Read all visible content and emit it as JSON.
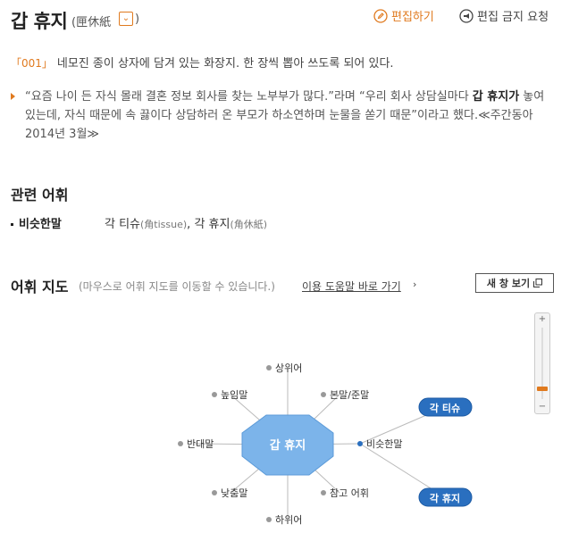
{
  "header": {
    "title": "갑 휴지",
    "hanja_open": "(",
    "hanja": "匣休紙",
    "hanja_toggle": "⌄",
    "hanja_close": ")",
    "edit_label": "편집하기",
    "block_label": "편집 금지 요청"
  },
  "definition": {
    "number": "「001」",
    "text": "네모진 종이 상자에 담겨 있는 화장지. 한 장씩 뽑아 쓰도록 되어 있다."
  },
  "example": {
    "part1": "“요즘 나이 든 자식 몰래 결혼 정보 회사를 찾는 노부부가 많다.”라며 “우리 회사 상담실마다 ",
    "bold": "갑 휴지가",
    "part2": " 놓여 있는데, 자식 때문에 속 끓이다 상담하러 온 부모가 하소연하며 눈물을 쏟기 때문”이라고 했다.≪주간동아 2014년 3월≫"
  },
  "related": {
    "title": "관련 어휘",
    "label": "비슷한말",
    "word1": "각 티슈",
    "word1_hanja": "(角tissue)",
    "sep": ", ",
    "word2": "각 휴지",
    "word2_hanja": "(角休紙)"
  },
  "word_map": {
    "title": "어휘 지도",
    "description": "(마우스로 어휘 지도를 이동할 수 있습니다.)",
    "help_link": "이용 도움말 바로 가기",
    "help_arrow": "›",
    "new_window": "새 창 보기",
    "center": "갑 휴지",
    "nodes": {
      "upper": "상위어",
      "honorific": "높임말",
      "original": "본말/준말",
      "antonym": "반대말",
      "synonym": "비슷한말",
      "humble": "낮춤말",
      "reference": "참고 어휘",
      "lower": "하위어"
    },
    "synonym_pills": [
      "각 티슈",
      "각 휴지"
    ],
    "zoom_plus": "+",
    "zoom_minus": "−",
    "colors": {
      "center": "#7cb4ea",
      "pill": "#2a6fbf",
      "accent": "#e07a1f"
    }
  }
}
